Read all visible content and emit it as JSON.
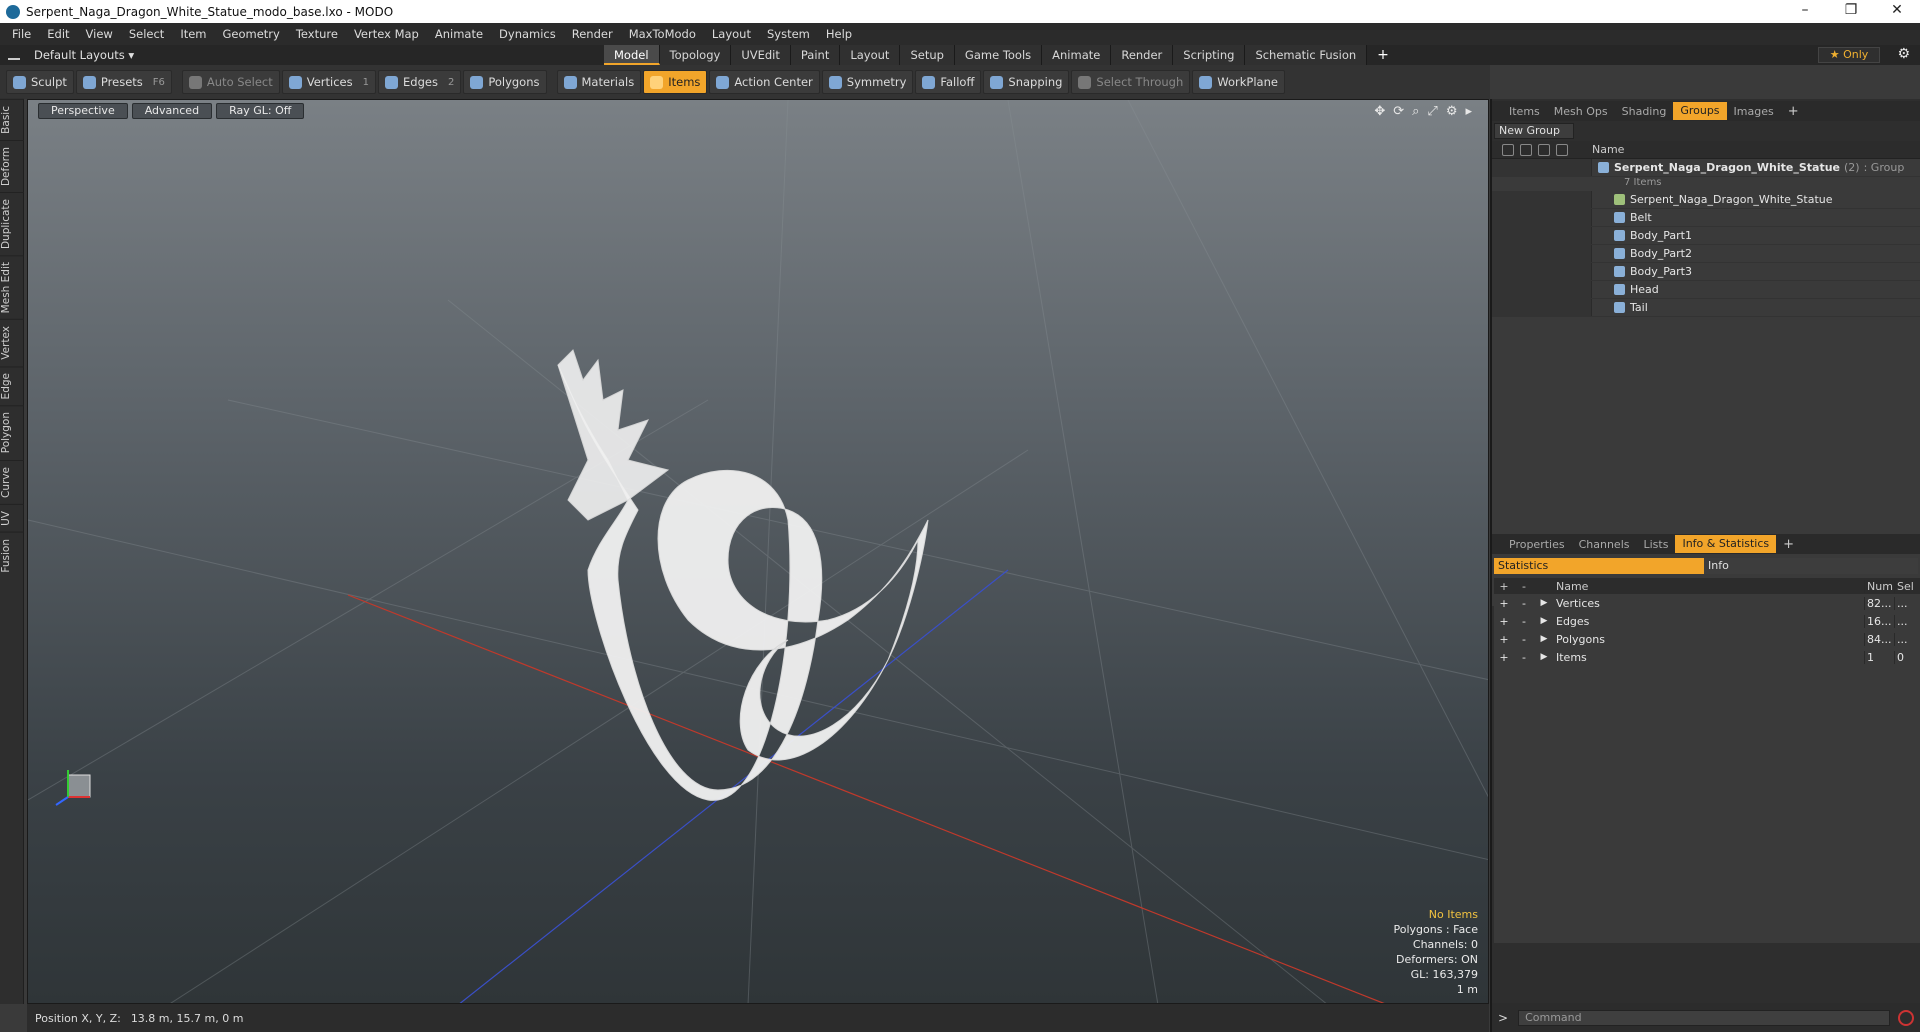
{
  "window": {
    "title": "Serpent_Naga_Dragon_White_Statue_modo_base.lxo - MODO",
    "min": "–",
    "max": "❐",
    "close": "✕"
  },
  "menu": [
    "File",
    "Edit",
    "View",
    "Select",
    "Item",
    "Geometry",
    "Texture",
    "Vertex Map",
    "Animate",
    "Dynamics",
    "Render",
    "MaxToModo",
    "Layout",
    "System",
    "Help"
  ],
  "layouts": {
    "label": "Default Layouts ▾"
  },
  "modeTabs": [
    "Model",
    "Topology",
    "UVEdit",
    "Paint",
    "Layout",
    "Setup",
    "Game Tools",
    "Animate",
    "Render",
    "Scripting",
    "Schematic Fusion"
  ],
  "activeModeTab": "Model",
  "only": "★  Only",
  "toolbar": {
    "sculpt": "Sculpt",
    "presets": "Presets",
    "presetsKey": "F6",
    "autoSelect": "Auto Select",
    "vertices": "Vertices",
    "verticesKey": "1",
    "edges": "Edges",
    "edgesKey": "2",
    "polygons": "Polygons",
    "materials": "Materials",
    "items": "Items",
    "actionCenter": "Action Center",
    "symmetry": "Symmetry",
    "falloff": "Falloff",
    "snapping": "Snapping",
    "selectThrough": "Select Through",
    "workPlane": "WorkPlane"
  },
  "leftTabs": [
    "Basic",
    "Deform",
    "Duplicate",
    "Mesh Edit",
    "Vertex",
    "Edge",
    "Polygon",
    "Curve",
    "UV",
    "Fusion"
  ],
  "viewport": {
    "perspective": "Perspective",
    "advanced": "Advanced",
    "rayGL": "Ray GL: Off",
    "info": {
      "noItems": "No Items",
      "polygons": "Polygons : Face",
      "channels": "Channels: 0",
      "deformers": "Deformers: ON",
      "gl": "GL: 163,379",
      "scale": "1 m"
    }
  },
  "status": {
    "label": "Position X, Y, Z:",
    "value": "13.8 m, 15.7 m, 0 m"
  },
  "rightTop": {
    "tabs": [
      "Items",
      "Mesh Ops",
      "Shading",
      "Groups",
      "Images"
    ],
    "activeTab": "Groups",
    "newGroup": "New Group",
    "nameHeader": "Name",
    "group": {
      "name": "Serpent_Naga_Dragon_White_Statue",
      "count": "(2)",
      "type": ": Group",
      "sub": "7 Items"
    },
    "items": [
      "Serpent_Naga_Dragon_White_Statue",
      "Belt",
      "Body_Part1",
      "Body_Part2",
      "Body_Part3",
      "Head",
      "Tail"
    ]
  },
  "rightBottom": {
    "tabs": [
      "Properties",
      "Channels",
      "Lists",
      "Info & Statistics"
    ],
    "activeTab": "Info & Statistics",
    "sub": {
      "statistics": "Statistics",
      "info": "Info"
    },
    "headers": {
      "name": "Name",
      "num": "Num",
      "sel": "Sel"
    },
    "rows": [
      {
        "name": "Vertices",
        "num": "82...",
        "sel": "..."
      },
      {
        "name": "Edges",
        "num": "16...",
        "sel": "..."
      },
      {
        "name": "Polygons",
        "num": "84...",
        "sel": "..."
      },
      {
        "name": "Items",
        "num": "1",
        "sel": "0"
      }
    ]
  },
  "command": {
    "placeholder": "Command"
  }
}
